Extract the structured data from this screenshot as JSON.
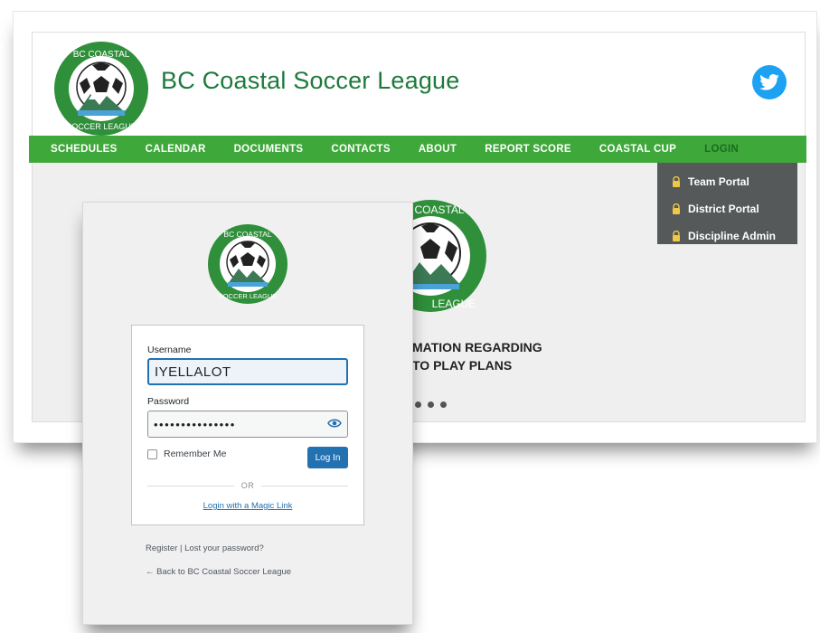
{
  "site": {
    "title": "BC Coastal Soccer League",
    "logo_text": "BC Coastal Soccer League",
    "nav": [
      "SCHEDULES",
      "CALENDAR",
      "DOCUMENTS",
      "CONTACTS",
      "ABOUT",
      "REPORT SCORE",
      "COASTAL CUP",
      "LOGIN"
    ],
    "active_nav": "LOGIN",
    "dropdown": [
      "Team Portal",
      "District Portal",
      "Discipline Admin"
    ],
    "hero_line1": "MATION REGARDING",
    "hero_line2": "TO PLAY PLANS",
    "slide_dots": 3,
    "social_icon": "twitter-icon"
  },
  "login": {
    "username_label": "Username",
    "username_value": "IYELLALOT",
    "password_label": "Password",
    "password_mask": "•••••••••••••••",
    "remember_label": "Remember Me",
    "login_button": "Log In",
    "or_text": "OR",
    "magic_link": "Login with a Magic Link",
    "register_nav": "Register | Lost your password?",
    "back_link": "← Back to BC Coastal Soccer League"
  },
  "colors": {
    "brand_green": "#3ea83a",
    "title_green": "#1e7a3c",
    "dropdown_bg": "#55595a",
    "wp_blue": "#2271b1",
    "twitter_blue": "#1da1f2"
  }
}
